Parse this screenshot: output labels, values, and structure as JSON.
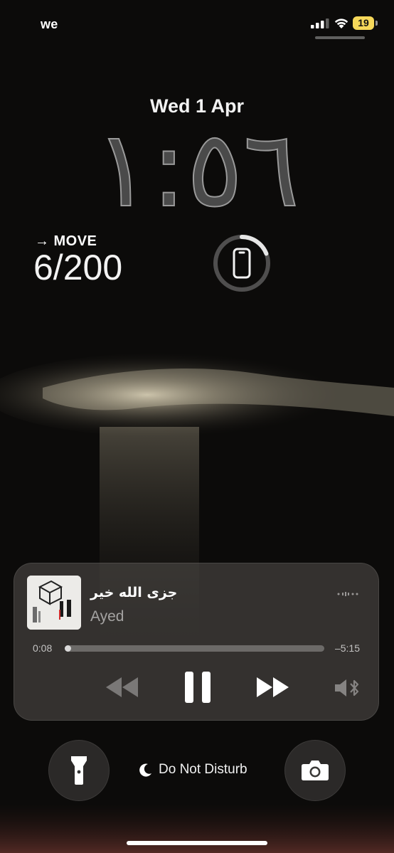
{
  "status_bar": {
    "carrier": "we",
    "battery_level": "19",
    "signal_bars": 3,
    "battery_color": "#f6d85a"
  },
  "lock": {
    "date": "Wed 1 Apr",
    "time": "١:٥٦"
  },
  "widgets": {
    "move_label": "MOVE",
    "move_value": "6/200",
    "phone_battery_ring_fraction": 0.19
  },
  "now_playing": {
    "title": "جزى الله خير",
    "artist": "Ayed",
    "elapsed": "0:08",
    "remaining": "–5:15",
    "progress_fraction": 0.025
  },
  "bottom_bar": {
    "focus_label": "Do Not Disturb"
  },
  "icons": {
    "status": [
      "signal-icon",
      "wifi-icon",
      "battery-icon"
    ],
    "widgets": [
      "arrow-right-icon",
      "phone-icon"
    ],
    "player": [
      "airplay-icon",
      "rewind-icon",
      "pause-icon",
      "fast-forward-icon",
      "bluetooth-speaker-icon"
    ],
    "bottom": [
      "flashlight-icon",
      "moon-icon",
      "camera-icon"
    ]
  }
}
